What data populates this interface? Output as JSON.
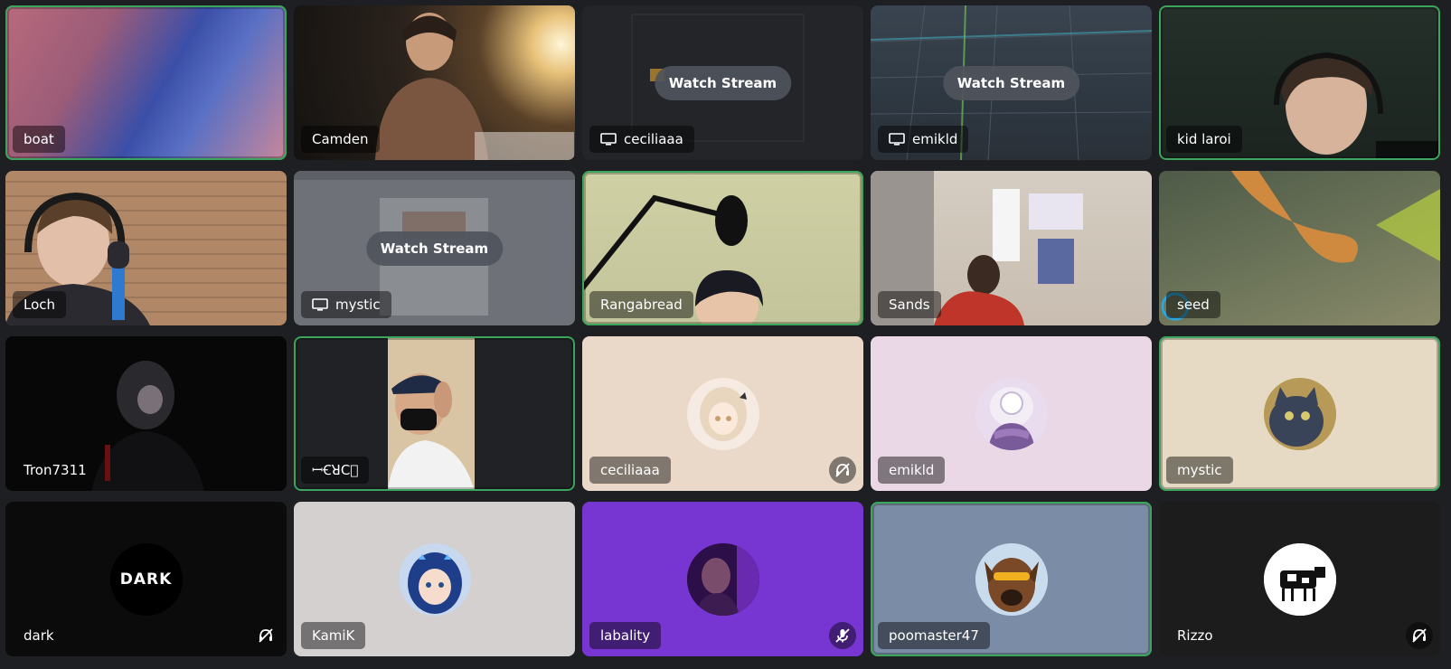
{
  "tiles": [
    {
      "name": "boat"
    },
    {
      "name": "Camden"
    },
    {
      "name": "ceciliaaa",
      "watch_label": "Watch Stream"
    },
    {
      "name": "emikld",
      "watch_label": "Watch Stream"
    },
    {
      "name": "kid laroi"
    },
    {
      "name": "Loch"
    },
    {
      "name": "mystic",
      "watch_label": "Watch Stream"
    },
    {
      "name": "Rangabread"
    },
    {
      "name": "Sands"
    },
    {
      "name": "seed"
    },
    {
      "name": "Tron7311"
    },
    {
      "name": "ꟷꞒꓤꓚ⃞"
    },
    {
      "name": "ceciliaaa"
    },
    {
      "name": "emikld"
    },
    {
      "name": "mystic"
    },
    {
      "name": "dark",
      "avatar_text": "DARK"
    },
    {
      "name": "KamiK"
    },
    {
      "name": "labality"
    },
    {
      "name": "poomaster47"
    },
    {
      "name": "Rizzo"
    }
  ],
  "colors": {
    "speaking_ring": "#3ba55d",
    "tile_beige": "#ead9c9",
    "tile_lilac": "#ead8e6",
    "tile_tan": "#e6dac4",
    "tile_grey": "#d4d0d0",
    "tile_purple": "#7735d2",
    "tile_slate": "#7b8ca7",
    "tile_dark": "#1c1c1c"
  }
}
